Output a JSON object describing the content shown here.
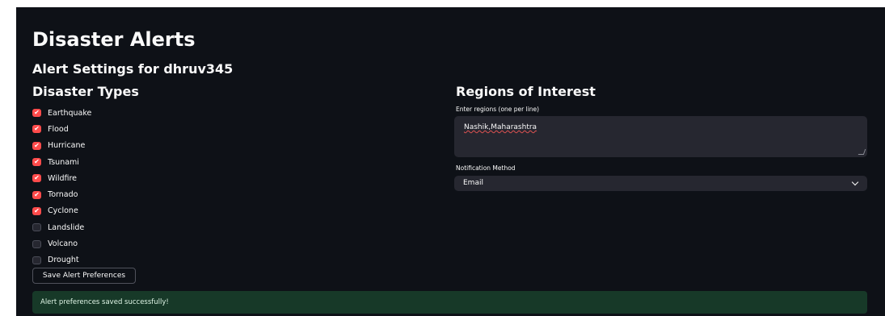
{
  "page": {
    "title": "Disaster Alerts",
    "subtitle": "Alert Settings for dhruv345"
  },
  "disaster_types": {
    "heading": "Disaster Types",
    "items": [
      {
        "label": "Earthquake",
        "checked": true
      },
      {
        "label": "Flood",
        "checked": true
      },
      {
        "label": "Hurricane",
        "checked": true
      },
      {
        "label": "Tsunami",
        "checked": true
      },
      {
        "label": "Wildfire",
        "checked": true
      },
      {
        "label": "Tornado",
        "checked": true
      },
      {
        "label": "Cyclone",
        "checked": true
      },
      {
        "label": "Landslide",
        "checked": false
      },
      {
        "label": "Volcano",
        "checked": false
      },
      {
        "label": "Drought",
        "checked": false
      }
    ],
    "save_button": "Save Alert Preferences"
  },
  "regions": {
    "heading": "Regions of Interest",
    "input_label": "Enter regions (one per line)",
    "input_value": "Nashik,Maharashtra"
  },
  "notification": {
    "label": "Notification Method",
    "selected": "Email"
  },
  "alert": {
    "message": "Alert preferences saved successfully!"
  },
  "colors": {
    "background": "#0e1117",
    "accent": "#ff4b4b",
    "input_bg": "#262730",
    "success_bg": "#173928"
  }
}
